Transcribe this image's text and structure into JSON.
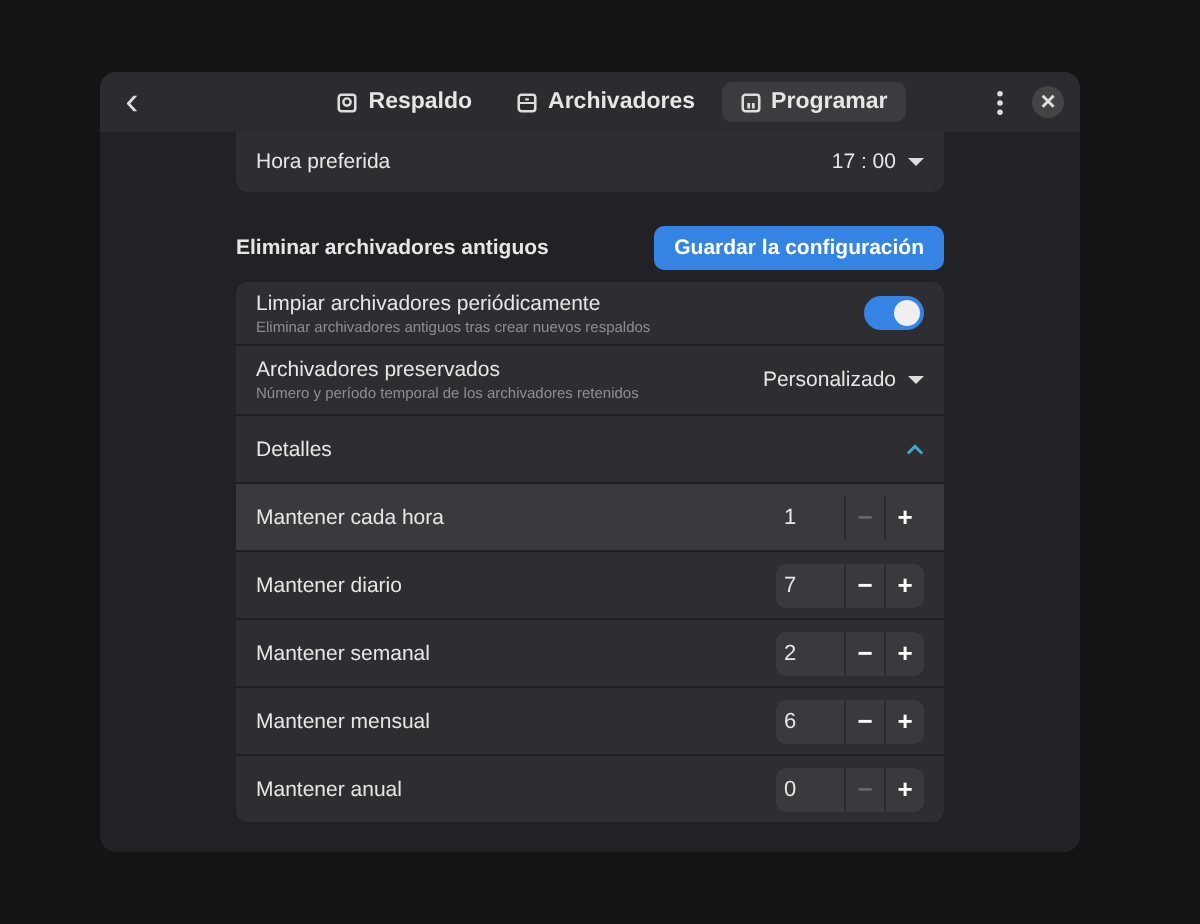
{
  "header": {
    "back": "‹",
    "tabs": [
      {
        "label": "Respaldo",
        "selected": false,
        "kind": "backup"
      },
      {
        "label": "Archivadores",
        "selected": false,
        "kind": "archive"
      },
      {
        "label": "Programar",
        "selected": true,
        "kind": "calendar"
      }
    ],
    "close": "×"
  },
  "preferred_time": {
    "label": "Hora preferida",
    "value": "17 : 00"
  },
  "section": {
    "title": "Eliminar archivadores antiguos",
    "save_button": "Guardar la configuración"
  },
  "cleanup": {
    "title": "Limpiar archivadores periódicamente",
    "subtitle": "Eliminar archivadores antiguos tras crear nuevos respaldos",
    "on": true
  },
  "preserved": {
    "title": "Archivadores preservados",
    "subtitle": "Número y período temporal de los archivadores retenidos",
    "value": "Personalizado"
  },
  "details": {
    "label": "Detalles",
    "expanded": true
  },
  "keep_rows": [
    {
      "label": "Mantener cada hora",
      "value": "1",
      "minus": "−",
      "plus": "+",
      "minus_disabled": true,
      "highlighted": true
    },
    {
      "label": "Mantener diario",
      "value": "7",
      "minus": "−",
      "plus": "+",
      "minus_disabled": false,
      "highlighted": false
    },
    {
      "label": "Mantener semanal",
      "value": "2",
      "minus": "−",
      "plus": "+",
      "minus_disabled": false,
      "highlighted": false
    },
    {
      "label": "Mantener mensual",
      "value": "6",
      "minus": "−",
      "plus": "+",
      "minus_disabled": false,
      "highlighted": false
    },
    {
      "label": "Mantener anual",
      "value": "0",
      "minus": "−",
      "plus": "+",
      "minus_disabled": true,
      "highlighted": false
    }
  ]
}
